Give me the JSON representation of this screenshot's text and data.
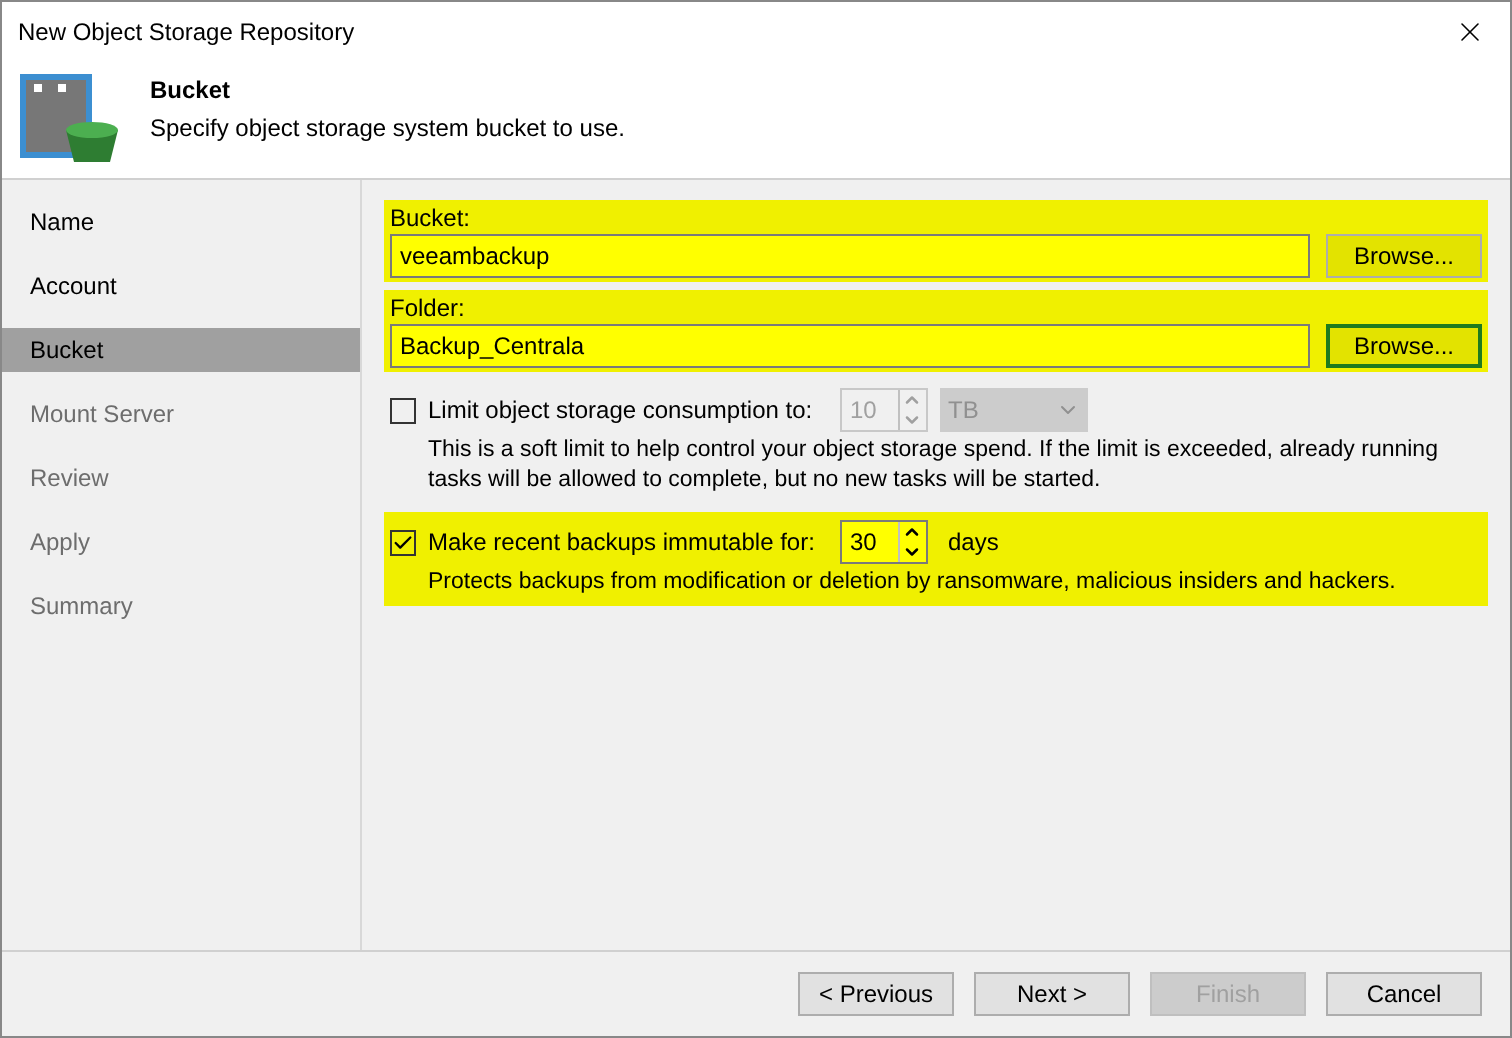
{
  "window": {
    "title": "New Object Storage Repository"
  },
  "header": {
    "title": "Bucket",
    "subtitle": "Specify object storage system bucket to use."
  },
  "steps": [
    {
      "label": "Name",
      "selected": false,
      "disabled": false
    },
    {
      "label": "Account",
      "selected": false,
      "disabled": false
    },
    {
      "label": "Bucket",
      "selected": true,
      "disabled": false
    },
    {
      "label": "Mount Server",
      "selected": false,
      "disabled": true
    },
    {
      "label": "Review",
      "selected": false,
      "disabled": true
    },
    {
      "label": "Apply",
      "selected": false,
      "disabled": true
    },
    {
      "label": "Summary",
      "selected": false,
      "disabled": true
    }
  ],
  "bucket": {
    "label": "Bucket:",
    "value": "veeambackup",
    "button": "Browse...",
    "highlighted": true
  },
  "folder": {
    "label": "Folder:",
    "value": "Backup_Centrala",
    "button": "Browse...",
    "highlighted": true,
    "focused": true
  },
  "limit": {
    "label": "Limit object storage consumption to:",
    "checked": false,
    "value": "10",
    "unit": "TB",
    "description": "This is a soft limit to help control your object storage spend. If the limit is exceeded, already running tasks will be allowed to complete, but no new tasks will be started.",
    "highlighted": false
  },
  "immutable": {
    "label": "Make recent backups immutable for:",
    "checked": true,
    "value": "30",
    "unit": "days",
    "description": "Protects backups from modification or deletion by ransomware, malicious insiders and hackers.",
    "highlighted": true
  },
  "buttons": [
    {
      "label": "< Previous",
      "disabled": false
    },
    {
      "label": "Next >",
      "disabled": false
    },
    {
      "label": "Finish",
      "disabled": true
    },
    {
      "label": "Cancel",
      "disabled": false
    }
  ]
}
